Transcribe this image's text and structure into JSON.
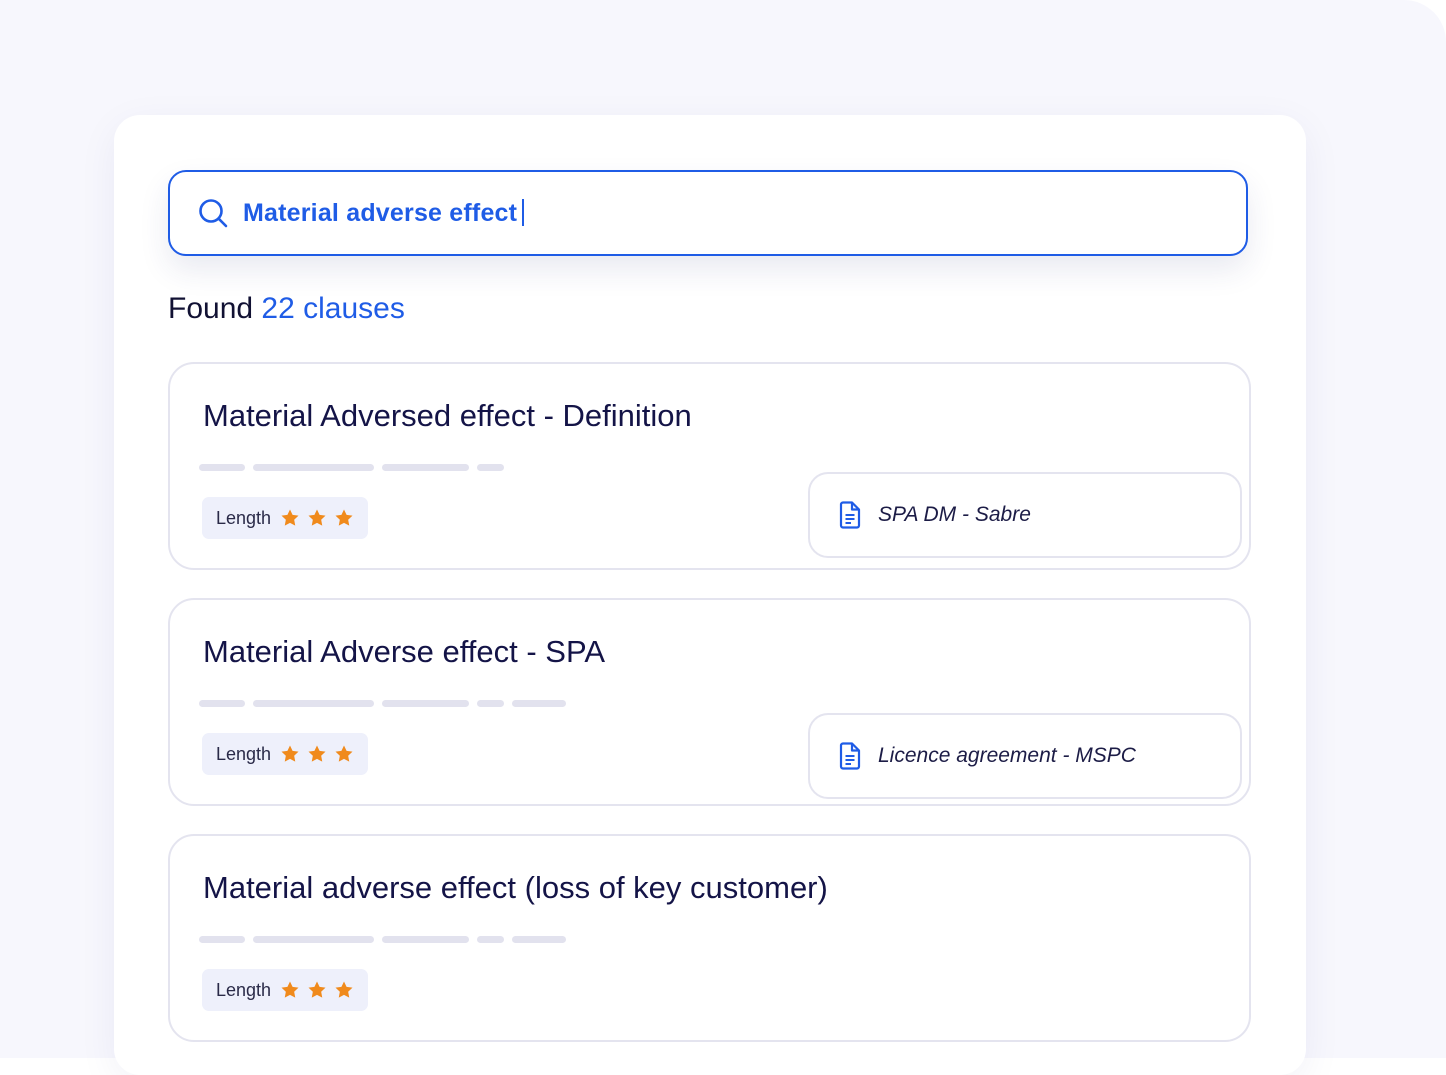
{
  "search": {
    "query": "Material adverse effect"
  },
  "results_summary": {
    "prefix": "Found",
    "count_text": "22 clauses"
  },
  "clauses": [
    {
      "title": "Material Adversed effect - Definition",
      "length_label": "Length",
      "length_rating": 3,
      "document": "SPA DM - Sabre"
    },
    {
      "title": "Material Adverse effect - SPA",
      "length_label": "Length",
      "length_rating": 3,
      "document": "Licence agreement - MSPC"
    },
    {
      "title": "Material adverse effect (loss of key customer)",
      "length_label": "Length",
      "length_rating": 3
    }
  ],
  "colors": {
    "accent": "#1f5ce6",
    "star": "#f08a1c",
    "title": "#141447"
  },
  "icons": {
    "search": "search-icon",
    "star": "star-icon",
    "document": "document-icon"
  }
}
